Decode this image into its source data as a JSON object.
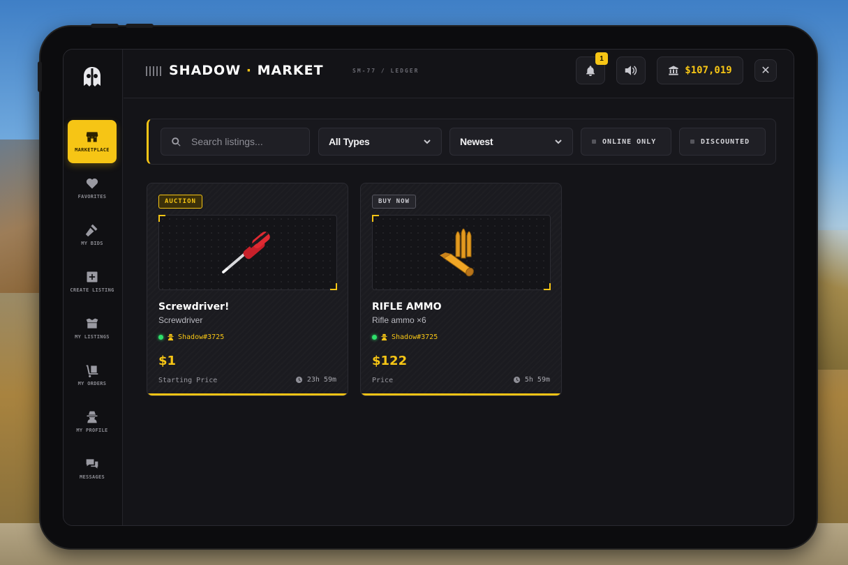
{
  "app": {
    "title_left": "SHADOW",
    "title_dot": "·",
    "title_right": "MARKET",
    "subtitle": "SM-77 / LEDGER",
    "notification_count": "1",
    "balance": "$107,019",
    "close_label": "✕"
  },
  "sidebar": {
    "items": [
      {
        "label": "MARKETPLACE",
        "icon": "shop-icon"
      },
      {
        "label": "FAVORITES",
        "icon": "heart-icon"
      },
      {
        "label": "MY BIDS",
        "icon": "gavel-icon"
      },
      {
        "label": "CREATE LISTING",
        "icon": "plus-square-icon"
      },
      {
        "label": "MY LISTINGS",
        "icon": "box-icon"
      },
      {
        "label": "MY ORDERS",
        "icon": "dolly-icon"
      },
      {
        "label": "MY PROFILE",
        "icon": "user-secret-icon"
      },
      {
        "label": "MESSAGES",
        "icon": "comments-icon"
      }
    ]
  },
  "filters": {
    "search_placeholder": "Search listings...",
    "type_value": "All Types",
    "sort_value": "Newest",
    "online_only": "ONLINE ONLY",
    "discounted": "DISCOUNTED"
  },
  "listings": [
    {
      "tag": "AUCTION",
      "title": "Screwdriver!",
      "subtitle": "Screwdriver",
      "seller": "Shadow#3725",
      "price": "$1",
      "price_label": "Starting Price",
      "time_left": "23h 59m"
    },
    {
      "tag": "BUY NOW",
      "title": "RIFLE AMMO",
      "subtitle": "Rifle ammo ×6",
      "seller": "Shadow#3725",
      "price": "$122",
      "price_label": "Price",
      "time_left": "5h 59m"
    }
  ],
  "colors": {
    "accent": "#f6c515",
    "online": "#2ee06b",
    "panel": "#141418"
  }
}
